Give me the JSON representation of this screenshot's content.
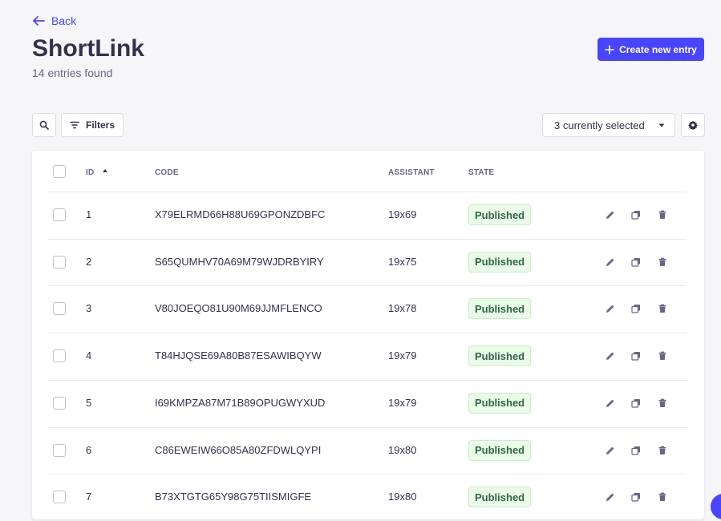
{
  "header": {
    "back_label": "Back",
    "title": "ShortLink",
    "subtitle": "14 entries found",
    "create_label": "Create new entry"
  },
  "toolbar": {
    "filters_label": "Filters",
    "columns_select_value": "3 currently selected"
  },
  "table": {
    "columns": [
      "ID",
      "CODE",
      "ASSISTANT",
      "STATE"
    ],
    "sort": {
      "column": "ID",
      "direction": "ascending"
    },
    "rows": [
      {
        "id": "1",
        "code": "X79ELRMD66H88U69GPONZDBFC",
        "assistant": "19x69",
        "state": "Published"
      },
      {
        "id": "2",
        "code": "S65QUMHV70A69M79WJDRBYIRY",
        "assistant": "19x75",
        "state": "Published"
      },
      {
        "id": "3",
        "code": "V80JOEQO81U90M69JJMFLENCO",
        "assistant": "19x78",
        "state": "Published"
      },
      {
        "id": "4",
        "code": "T84HJQSE69A80B87ESAWIBQYW",
        "assistant": "19x79",
        "state": "Published"
      },
      {
        "id": "5",
        "code": "I69KMPZA87M71B89OPUGWYXUD",
        "assistant": "19x79",
        "state": "Published"
      },
      {
        "id": "6",
        "code": "C86EWEIW66O85A80ZFDWLQYPI",
        "assistant": "19x80",
        "state": "Published"
      },
      {
        "id": "7",
        "code": "B73XTGTG65Y98G75TIISMIGFE",
        "assistant": "19x80",
        "state": "Published"
      }
    ]
  },
  "colors": {
    "primary": "#4945ff",
    "background": "#f6f6f9",
    "published_bg": "#eafbe7",
    "published_text": "#2f6846"
  },
  "icons": {
    "back": "arrow-left-icon",
    "create": "plus-icon",
    "search": "search-icon",
    "filters": "filter-icon",
    "select": "chevron-down-icon",
    "settings": "gear-icon",
    "edit": "pencil-icon",
    "duplicate": "duplicate-icon",
    "delete": "trash-icon"
  }
}
